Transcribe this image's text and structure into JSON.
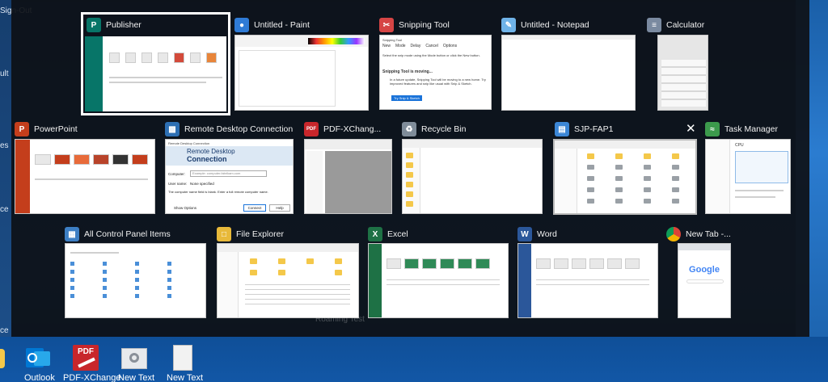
{
  "desktop": {
    "left_labels": [
      "Sign-Out",
      "ult",
      "es",
      "ce",
      "ce"
    ],
    "bottom_icons": [
      {
        "label": "Outlook",
        "icon": "outlook-icon"
      },
      {
        "label": "PDF-XChange",
        "icon": "pdf-xchange-icon"
      },
      {
        "label": "New Text",
        "icon": "settings-doc-icon"
      },
      {
        "label": "New Text",
        "icon": "text-doc-icon"
      }
    ],
    "faint_label": "Roaming Test"
  },
  "windows": [
    {
      "title": "Publisher",
      "icon": "publisher-icon",
      "color": "#077568",
      "selected": true
    },
    {
      "title": "Untitled - Paint",
      "icon": "paint-icon",
      "color": "#2f7bd6"
    },
    {
      "title": "Snipping Tool",
      "icon": "snipping-tool-icon",
      "color": "#d64545",
      "content": {
        "toolbar": [
          "New",
          "Mode",
          "Delay",
          "Cancel",
          "Options"
        ],
        "hint": "Select the snip mode using the Mode button or click the New button.",
        "moving": "Snipping Tool is moving...",
        "moving_text": "In a future update, Snipping Tool will be moving to a new home. Try improved features and snip like usual with Snip & Sketch.",
        "try_button": "Try Snip & Sketch"
      }
    },
    {
      "title": "Untitled - Notepad",
      "icon": "notepad-icon",
      "color": "#6fb3e8"
    },
    {
      "title": "Calculator",
      "icon": "calculator-icon",
      "color": "#7a8aa0"
    },
    {
      "title": "PowerPoint",
      "icon": "powerpoint-icon",
      "color": "#c43e1c"
    },
    {
      "title": "Remote Desktop Connection",
      "icon": "remote-desktop-icon",
      "color": "#2d6fb3",
      "content": {
        "window_title": "Remote Desktop Connection",
        "heading1": "Remote Desktop",
        "heading2": "Connection",
        "computer_label": "Computer:",
        "computer_placeholder": "Example: computer.fabrikam.com",
        "user_label": "User name:",
        "user_value": "None specified",
        "note": "The computer name field is blank. Enter a full remote computer name.",
        "show_options": "Show Options",
        "connect": "Connect",
        "help": "Help"
      }
    },
    {
      "title": "PDF-XChang...",
      "icon": "pdf-icon",
      "color": "#c8262b"
    },
    {
      "title": "Recycle Bin",
      "icon": "recycle-bin-icon",
      "color": "#7f8c99"
    },
    {
      "title": "SJP-FAP1",
      "icon": "network-computer-icon",
      "color": "#3b86d6"
    },
    {
      "title": "Task Manager",
      "icon": "task-manager-icon",
      "color": "#3c9a4c",
      "content": {
        "cpu_label": "CPU"
      }
    },
    {
      "title": "All Control Panel Items",
      "icon": "control-panel-icon",
      "color": "#3d7fc4"
    },
    {
      "title": "File Explorer",
      "icon": "file-explorer-icon",
      "color": "#e8b93a"
    },
    {
      "title": "Excel",
      "icon": "excel-icon",
      "color": "#1e7145"
    },
    {
      "title": "Word",
      "icon": "word-icon",
      "color": "#2b579a"
    },
    {
      "title": "New Tab -...",
      "icon": "chrome-icon",
      "color": "#dd4b39",
      "content": {
        "google": "Google"
      }
    }
  ],
  "icon_glyphs": {
    "publisher": "P",
    "powerpoint": "P",
    "excel": "X",
    "word": "W",
    "pdf": "PDF"
  }
}
